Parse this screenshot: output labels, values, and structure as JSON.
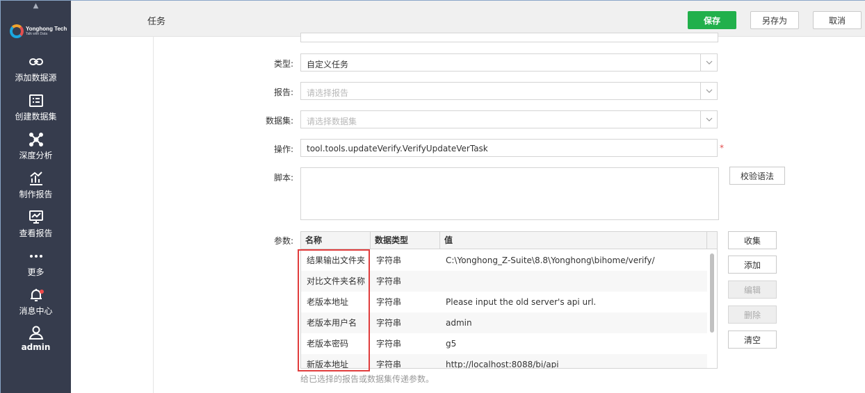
{
  "sidebar": {
    "brand": "Yonghong Tech",
    "slogan": "Talk with Data",
    "items": [
      {
        "label": "添加数据源",
        "icon": "link-icon"
      },
      {
        "label": "创建数据集",
        "icon": "dataset-icon"
      },
      {
        "label": "深度分析",
        "icon": "analysis-icon"
      },
      {
        "label": "制作报告",
        "icon": "bar-chart-icon"
      },
      {
        "label": "查看报告",
        "icon": "monitor-chart-icon"
      },
      {
        "label": "更多",
        "icon": "more-dots-icon"
      },
      {
        "label": "消息中心",
        "icon": "bell-icon"
      },
      {
        "label": "admin",
        "icon": "user-icon"
      }
    ]
  },
  "header": {
    "title": "任务",
    "save_label": "保存",
    "save_as_label": "另存为",
    "cancel_label": "取消"
  },
  "form": {
    "type": {
      "label": "类型:",
      "value": "自定义任务"
    },
    "report": {
      "label": "报告:",
      "placeholder": "请选择报告"
    },
    "dataset": {
      "label": "数据集:",
      "placeholder": "请选择数据集"
    },
    "operation": {
      "label": "操作:",
      "value": "tool.tools.updateVerify.VerifyUpdateVerTask",
      "required_mark": "*"
    },
    "script": {
      "label": "脚本:",
      "check_label": "校验语法"
    },
    "params": {
      "label": "参数:",
      "columns": [
        "名称",
        "数据类型",
        "值"
      ],
      "rows": [
        {
          "name": "结果输出文件夹",
          "type": "字符串",
          "value": "C:\\Yonghong_Z-Suite\\8.8\\Yonghong\\bihome/verify/"
        },
        {
          "name": "对比文件夹名称",
          "type": "字符串",
          "value": ""
        },
        {
          "name": "老版本地址",
          "type": "字符串",
          "value": "Please input the old server's api url."
        },
        {
          "name": "老版本用户名",
          "type": "字符串",
          "value": "admin"
        },
        {
          "name": "老版本密码",
          "type": "字符串",
          "value": "g5"
        },
        {
          "name": "新版本地址",
          "type": "字符串",
          "value": "http://localhost:8088/bi/api"
        }
      ],
      "buttons": {
        "collect": "收集",
        "add": "添加",
        "edit": "编辑",
        "delete": "删除",
        "clear": "清空"
      },
      "hint": "给已选择的报告或数据集传递参数。"
    }
  },
  "colors": {
    "sidebar_bg": "#363c4d",
    "primary": "#21b04b",
    "highlight": "#e03c3c"
  }
}
